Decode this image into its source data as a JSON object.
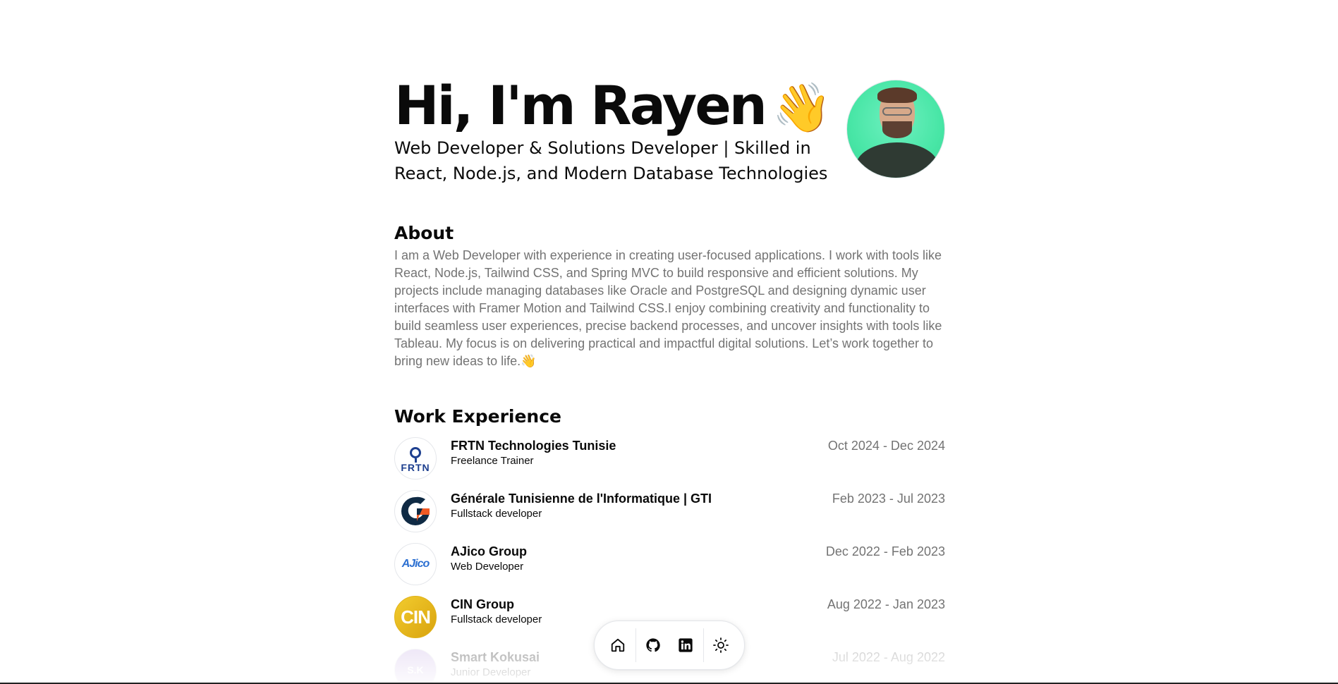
{
  "hero": {
    "title": "Hi, I'm Rayen",
    "wave_emoji": "👋",
    "subtitle": "Web Developer & Solutions Developer | Skilled in React, Node.js, and Modern Database Technologies",
    "avatar_icon": "profile-photo"
  },
  "about": {
    "title": "About",
    "text": "I am a Web Developer with experience in creating user-focused applications. I work with tools like React, Node.js, Tailwind CSS, and Spring MVC to build responsive and efficient solutions. My projects include managing databases like Oracle and PostgreSQL and designing dynamic user interfaces with Framer Motion and Tailwind CSS.I enjoy combining creativity and functionality to build seamless user experiences, precise backend processes, and uncover insights with tools like Tableau. My focus is on delivering practical and impactful digital solutions. Let’s work together to bring new ideas to life.👋"
  },
  "work": {
    "title": "Work Experience",
    "jobs": [
      {
        "company": "FRTN Technologies Tunisie",
        "role": "Freelance Trainer",
        "dates": "Oct 2024 - Dec 2024",
        "logo_text": "FRTN"
      },
      {
        "company": "Générale Tunisienne de l'Informatique | GTI",
        "role": "Fullstack developer",
        "dates": "Feb 2023 - Jul 2023",
        "logo_text": ""
      },
      {
        "company": "AJico Group",
        "role": "Web Developer",
        "dates": "Dec 2022 - Feb 2023",
        "logo_text": "AJico"
      },
      {
        "company": "CIN Group",
        "role": "Fullstack developer",
        "dates": "Aug 2022 - Jan 2023",
        "logo_text": "CIN"
      },
      {
        "company": "Smart Kokusai",
        "role": "Junior Developer",
        "dates": "Jul 2022 - Aug 2022",
        "logo_text": "S.K"
      }
    ]
  },
  "dock": {
    "items": [
      "home-icon",
      "github-icon",
      "linkedin-icon",
      "sun-icon"
    ]
  },
  "colors": {
    "text": "#0a0a0a",
    "muted": "#737373",
    "avatar_bg": "#48e6a6",
    "gti_orange": "#f15a24",
    "gti_navy": "#0f2a44"
  }
}
